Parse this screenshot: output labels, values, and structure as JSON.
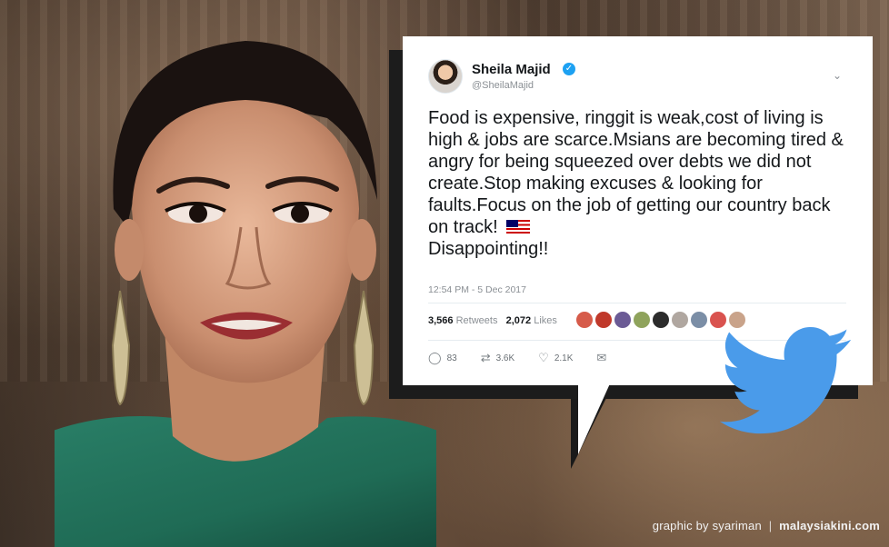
{
  "tweet": {
    "display_name": "Sheila Majid",
    "handle": "@SheilaMajid",
    "text": "Food is expensive, ringgit is weak,cost of living is high & jobs are scarce.Msians are becoming tired & angry for being squeezed over debts we did not create.Stop making excuses & looking for faults.Focus on the job of getting our country back on track!",
    "text_end": "Disappointing!!",
    "timestamp": "12:54 PM - 5 Dec 2017",
    "retweets_count": "3,566",
    "retweets_label": "Retweets",
    "likes_count": "2,072",
    "likes_label": "Likes",
    "actions": {
      "reply": "83",
      "retweet": "3.6K",
      "like": "2.1K"
    }
  },
  "credit": {
    "prefix": "graphic by syariman",
    "separator": "|",
    "brand": "malaysiakini.com"
  },
  "colors": {
    "twitter_blue": "#1da1f2",
    "bird_blue": "#4a9bea",
    "text_dark": "#14171a",
    "text_gray": "#8a8f94",
    "dress_green": "#1f6b55"
  },
  "icons": [
    "verified-badge-icon",
    "chevron-down-icon",
    "malaysia-flag-icon",
    "reply-icon",
    "retweet-icon",
    "like-icon",
    "message-icon",
    "twitter-bird-icon"
  ]
}
